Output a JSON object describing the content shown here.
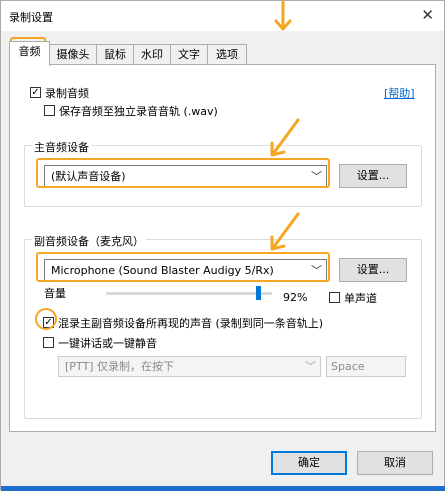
{
  "window": {
    "title": "录制设置",
    "close_symbol": "✕"
  },
  "tabs": [
    {
      "label": "音频",
      "active": true
    },
    {
      "label": "摄像头",
      "active": false
    },
    {
      "label": "鼠标",
      "active": false
    },
    {
      "label": "水印",
      "active": false
    },
    {
      "label": "文字",
      "active": false
    },
    {
      "label": "选项",
      "active": false
    }
  ],
  "record_audio": {
    "label": "录制音频",
    "checked": true
  },
  "help_link": "[帮助]",
  "save_separate": {
    "label": "保存音频至独立录音音轨 (.wav)",
    "checked": false
  },
  "main_device": {
    "group_label": "主音频设备",
    "selected": "(默认声音设备)",
    "settings_label": "设置..."
  },
  "secondary_device": {
    "group_label": "副音频设备（麦克风）",
    "selected": "Microphone (Sound Blaster Audigy 5/Rx)",
    "settings_label": "设置...",
    "volume_label": "音量",
    "volume_percent": "92%",
    "volume_value": 0.92,
    "mono_label": "单声道",
    "mono_checked": false
  },
  "mix_audio": {
    "label": "混录主副音频设备所再现的声音 (录制到同一条音轨上)",
    "checked": true
  },
  "push_to_talk": {
    "label": "一键讲话或一键静音",
    "checked": false,
    "mode_selected": "[PTT] 仅录制，在按下",
    "hotkey": "Space"
  },
  "buttons": {
    "ok": "确定",
    "cancel": "取消"
  },
  "colors": {
    "highlight": "#f5a623",
    "link": "#0066cc",
    "accent": "#0078d7"
  }
}
